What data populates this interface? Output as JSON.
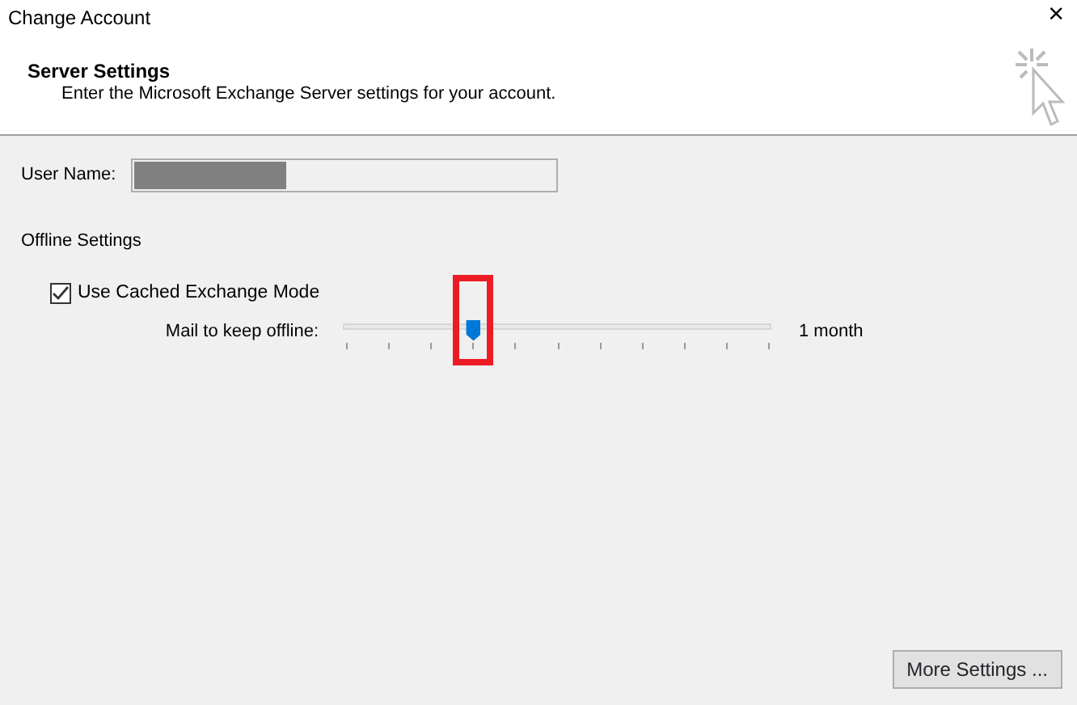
{
  "window": {
    "title": "Change Account",
    "close": "×"
  },
  "header": {
    "title": "Server Settings",
    "subtitle": "Enter the Microsoft Exchange Server settings for your account."
  },
  "user_name": {
    "label": "User Name:",
    "redacted": true
  },
  "offline": {
    "title": "Offline Settings",
    "cached_mode": {
      "label": "Use Cached Exchange Mode",
      "checked": true
    },
    "slider": {
      "label": "Mail to keep offline:",
      "level": 0.3,
      "highlighted": true,
      "reading": "1 month"
    }
  },
  "buttons": [
    "More Settings ..."
  ]
}
